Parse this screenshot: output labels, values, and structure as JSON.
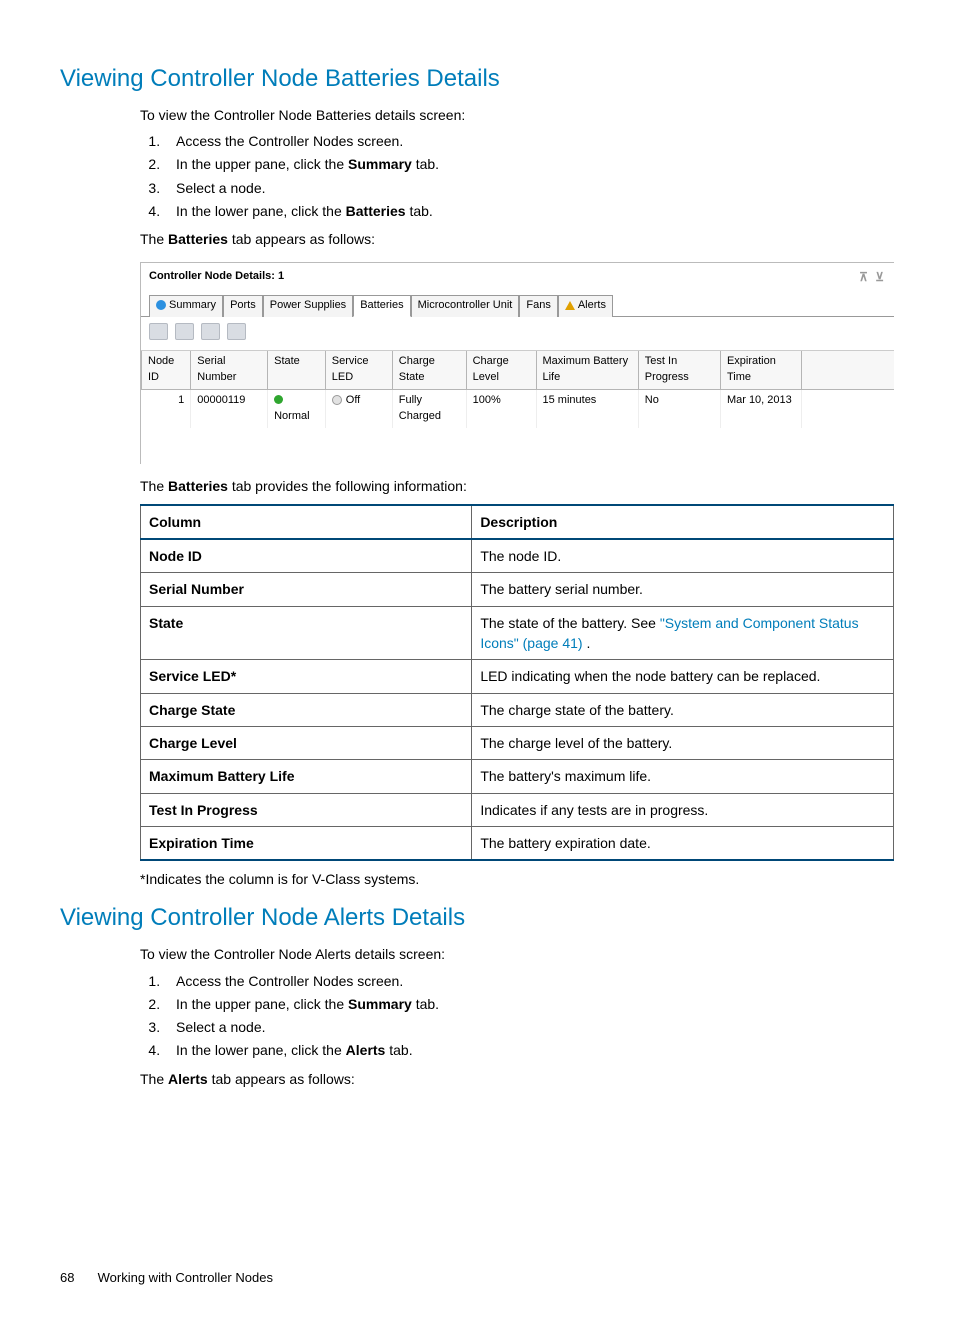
{
  "section1": {
    "title": "Viewing Controller Node Batteries Details",
    "intro": "To view the Controller Node Batteries details screen:",
    "step1": "Access the Controller Nodes screen.",
    "step2_a": "In the upper pane, click the ",
    "step2_b": "Summary",
    "step2_c": " tab.",
    "step3": "Select a node.",
    "step4_a": "In the lower pane, click the ",
    "step4_b": "Batteries",
    "step4_c": " tab.",
    "after_a": "The ",
    "after_b": "Batteries",
    "after_c": " tab appears as follows:"
  },
  "sshot": {
    "title": "Controller Node Details: 1",
    "tabs": {
      "summary": "Summary",
      "ports": "Ports",
      "power": "Power Supplies",
      "batteries": "Batteries",
      "mcu": "Microcontroller Unit",
      "fans": "Fans",
      "alerts": "Alerts"
    },
    "headers": {
      "node_id": "Node ID",
      "serial": "Serial Number",
      "state": "State",
      "service_led": "Service LED",
      "charge_state": "Charge State",
      "charge_level": "Charge Level",
      "max_life": "Maximum Battery Life",
      "test": "Test In Progress",
      "exp": "Expiration Time"
    },
    "row": {
      "node_id": "1",
      "serial": "00000119",
      "state": "Normal",
      "service_led": "Off",
      "charge_state": "Fully Charged",
      "charge_level": "100%",
      "max_life": "15 minutes",
      "test": "No",
      "exp": "Mar 10, 2013"
    }
  },
  "def_intro_a": "The ",
  "def_intro_b": "Batteries",
  "def_intro_c": " tab provides the following information:",
  "def": {
    "h1": "Column",
    "h2": "Description",
    "r1c": "Node ID",
    "r1d": "The node ID.",
    "r2c": "Serial Number",
    "r2d": "The battery serial number.",
    "r3c": "State",
    "r3d_a": "The state of the battery. See ",
    "r3d_link": "\"System and Component Status Icons\" (page 41)",
    "r3d_b": " .",
    "r4c": "Service LED*",
    "r4d": "LED indicating when the node battery can be replaced.",
    "r5c": "Charge State",
    "r5d": "The charge state of the battery.",
    "r6c": "Charge Level",
    "r6d": "The charge level of the battery.",
    "r7c": "Maximum Battery Life",
    "r7d": "The battery's maximum life.",
    "r8c": "Test In Progress",
    "r8d": "Indicates if any tests are in progress.",
    "r9c": "Expiration Time",
    "r9d": "The battery expiration date."
  },
  "footnote": "*Indicates the column is for V-Class systems.",
  "section2": {
    "title": "Viewing Controller Node Alerts Details",
    "intro": "To view the Controller Node Alerts details screen:",
    "step1": "Access the Controller Nodes screen.",
    "step2_a": "In the upper pane, click the ",
    "step2_b": "Summary",
    "step2_c": " tab.",
    "step3": "Select a node.",
    "step4_a": "In the lower pane, click the ",
    "step4_b": "Alerts",
    "step4_c": " tab.",
    "after_a": "The ",
    "after_b": "Alerts",
    "after_c": " tab appears as follows:"
  },
  "footer": {
    "page": "68",
    "chapter": "Working with Controller Nodes"
  }
}
